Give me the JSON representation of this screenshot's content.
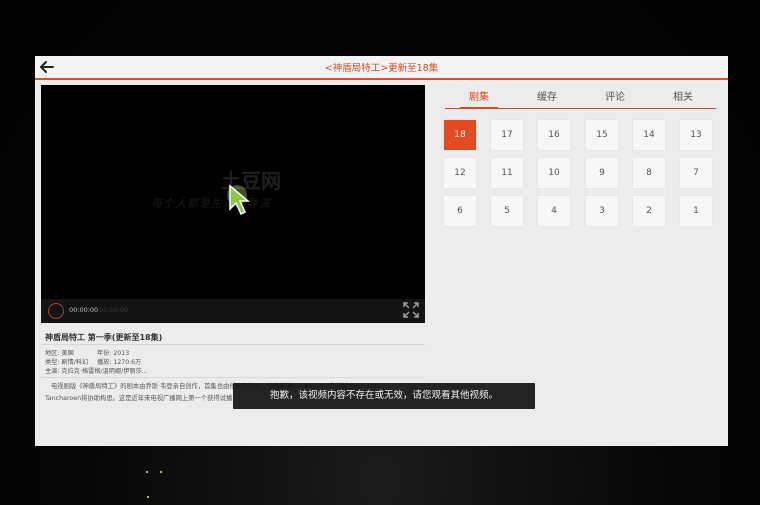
{
  "header": {
    "title": "<神盾局特工>更新至18集"
  },
  "player": {
    "watermark_logo": "土豆网",
    "watermark_slogan": "每个人都是生活的导演",
    "time_current": "00:00:00",
    "time_total": "00:00:00"
  },
  "info": {
    "title": "神盾局特工 第一季(更新至18集)",
    "region": "地区: 美国",
    "year": "年份: 2013",
    "genre": "类型: 剧情/科幻",
    "plays": "播放: 1270.6万",
    "cast": "主演: 克拉克·格雷格/温明娜/伊丽莎...",
    "desc_line1": "电视剧版《神盾局特工》的剧本由乔斯·韦登亲自创作，首集也由他亲自执导，他的弟弟Jed Whedon和弟媳Maurissa",
    "desc_line2": "Tancharoen将协助构思。这是近年来电视广播网上第一个获得试播"
  },
  "tabs": [
    "剧集",
    "缓存",
    "评论",
    "相关"
  ],
  "episodes": [
    "18",
    "17",
    "16",
    "15",
    "14",
    "13",
    "12",
    "11",
    "10",
    "9",
    "8",
    "7",
    "6",
    "5",
    "4",
    "3",
    "2",
    "1"
  ],
  "toast": {
    "message": "抱歉，该视频内容不存在或无效，请您观看其他视频。"
  },
  "colors": {
    "accent": "#d84a22",
    "background": "#ececec",
    "player": "#000000"
  }
}
